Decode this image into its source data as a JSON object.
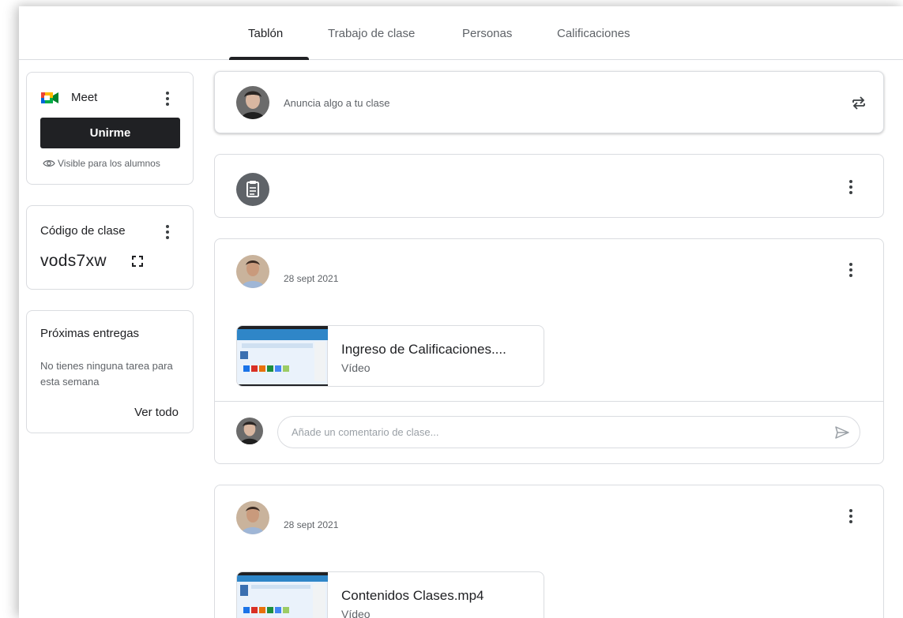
{
  "tabs": [
    "Tablón",
    "Trabajo de clase",
    "Personas",
    "Calificaciones"
  ],
  "meet": {
    "title": "Meet",
    "join_label": "Unirme",
    "visibility": "Visible para los alumnos",
    "icon": "google-meet-icon"
  },
  "class_code": {
    "title": "Código de clase",
    "code": "vods7xw"
  },
  "upcoming": {
    "title": "Próximas entregas",
    "empty_text": "No tienes ninguna tarea para esta semana",
    "link": "Ver todo"
  },
  "announce": {
    "placeholder": "Anuncia algo a tu clase"
  },
  "posts": [
    {
      "date": "28 sept 2021",
      "attachment_title": "Ingreso de Calificaciones....",
      "attachment_type": "Vídeo",
      "comment_placeholder": "Añade un comentario de clase..."
    },
    {
      "date": "28 sept 2021",
      "attachment_title": "Contenidos Clases.mp4",
      "attachment_type": "Vídeo"
    }
  ],
  "colors": {
    "text_primary": "#202124",
    "text_secondary": "#5f6368",
    "border": "#dadce0",
    "button_dark": "#202124"
  }
}
